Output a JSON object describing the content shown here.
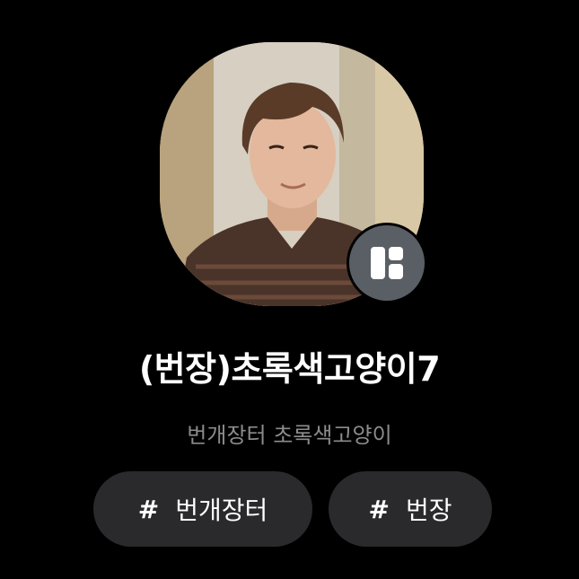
{
  "profile": {
    "name": "(번장)초록색고양이7",
    "subtitle": "번개장터 초록색고양이",
    "avatar_alt": "profile photo",
    "badge_icon": "app-grid-icon"
  },
  "tags": [
    {
      "hash": "#",
      "label": "번개장터"
    },
    {
      "hash": "#",
      "label": "번장"
    }
  ],
  "colors": {
    "background": "#000000",
    "chip": "#2a2a2c",
    "subtitle": "#8c8c8c",
    "badge": "#5a5f66"
  }
}
